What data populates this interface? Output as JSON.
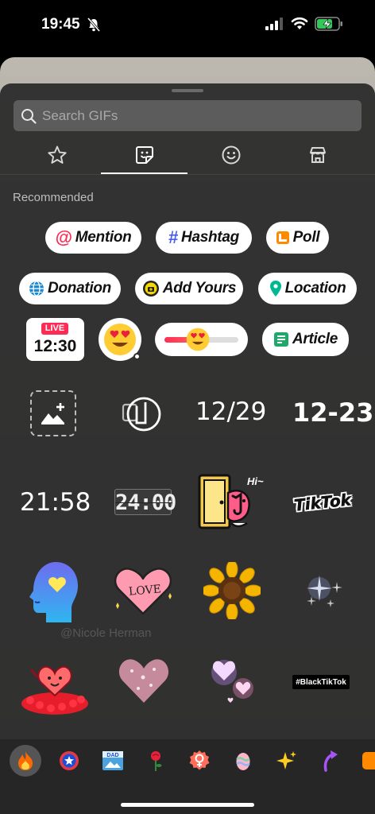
{
  "status_bar": {
    "time": "19:45"
  },
  "search": {
    "placeholder": "Search GIFs"
  },
  "tabs": [
    "favorites-icon",
    "stickers-icon",
    "emoji-icon",
    "store-icon"
  ],
  "section": {
    "title": "Recommended"
  },
  "stickers": {
    "mention": "Mention",
    "hashtag": "Hashtag",
    "poll": "Poll",
    "donation": "Donation",
    "add_yours": "Add Yours",
    "location": "Location",
    "live_badge": "LIVE",
    "live_time": "12:30",
    "article": "Article"
  },
  "grid": {
    "date1": "12/29",
    "date2": "12-23",
    "time1": "21:58",
    "time2": "24:00",
    "hi": "Hi~",
    "tiktok": "TikTok",
    "love": "LOVE",
    "black_tiktok": "#BlackTikTok"
  },
  "watermark": "@Nicole Herman",
  "colors": {
    "accent_pink": "#fe2c55",
    "sheet": "#2e2e2e",
    "tray": "#262626"
  }
}
